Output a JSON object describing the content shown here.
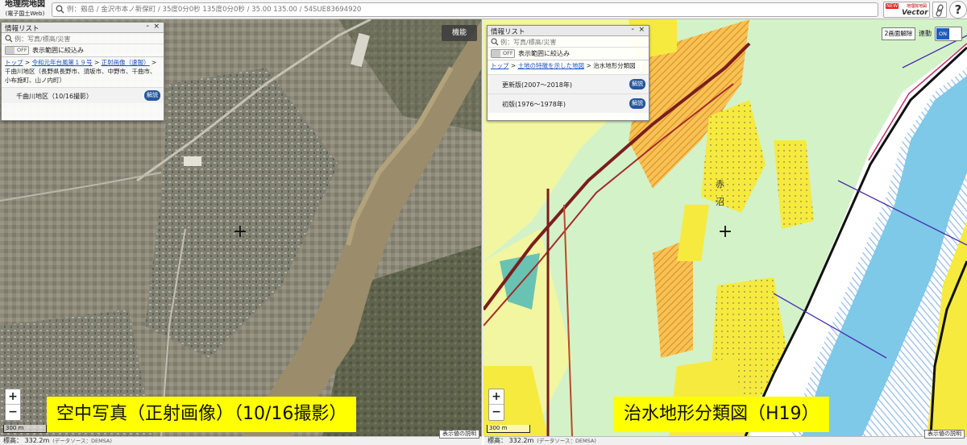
{
  "app": {
    "logo_line1": "地理院地図",
    "logo_line2": "(電子国土Web)"
  },
  "search": {
    "placeholder": "例：剱岳 / 金沢市本ノ新保町 / 35度0分0秒 135度0分0秒 / 35.00 135.00 / 54SUE83694920"
  },
  "toolbar": {
    "new_badge": "NEW",
    "vector_small": "地理院地図",
    "vector_label": "Vector",
    "help_label": "?"
  },
  "left": {
    "panel": {
      "title": "情報リスト",
      "minimize": "-",
      "close": "×",
      "search_placeholder": "例：写真/標高/災害",
      "toggle_state": "OFF",
      "toggle_label": "表示範囲に絞込み",
      "crumb_top": "トップ",
      "crumb_1": "令和元年台風第１９号",
      "crumb_2": "正射画像（速報）",
      "crumb_rest": "> 千曲川地区（長野県長野市、須坂市、中野市、千曲市、小布施町、山ノ内町）",
      "layer_name": "千曲川地区（10/16撮影）",
      "layer_btn": "解説"
    },
    "function_button": "機能",
    "zoom_in": "+",
    "zoom_out": "−",
    "scale_label": "300 m",
    "caption": "空中写真（正射画像）（10/16撮影）",
    "elevation": "標高： 332.2m",
    "source": "(データソース：DEMSA)",
    "value_desc_button": "表示値の説明"
  },
  "right": {
    "panel": {
      "title": "情報リスト",
      "minimize": "-",
      "close": "×",
      "search_placeholder": "例：写真/標高/災害",
      "toggle_state": "OFF",
      "toggle_label": "表示範囲に絞込み",
      "crumb_top": "トップ",
      "crumb_1": "土地の特徴を示した地図",
      "crumb_rest": "> 治水地形分類図",
      "layers": [
        {
          "name": "更新版(2007～2018年)",
          "btn": "解説"
        },
        {
          "name": "初版(1976～1978年)",
          "btn": "解説"
        }
      ]
    },
    "dual_button": "2画面解除",
    "sync_label": "連動",
    "sync_state": "ON",
    "zoom_in": "+",
    "zoom_out": "−",
    "scale_label": "300 m",
    "caption": "治水地形分類図（H19）",
    "elevation": "標高： 332.2m",
    "source": "(データソース：DEMSA)",
    "value_desc_button": "表示値の説明",
    "map_labels": {
      "aka": "赤",
      "numa": "沼"
    }
  },
  "colors": {
    "kaisetsu_blue": "#26579c",
    "caption_yellow": "#ffff00",
    "sync_on_blue": "#1f5db8",
    "terrain_green": "#d4f2c8",
    "flood_yellow": "#f7ea3a",
    "river_blue": "#7ec8e8"
  }
}
